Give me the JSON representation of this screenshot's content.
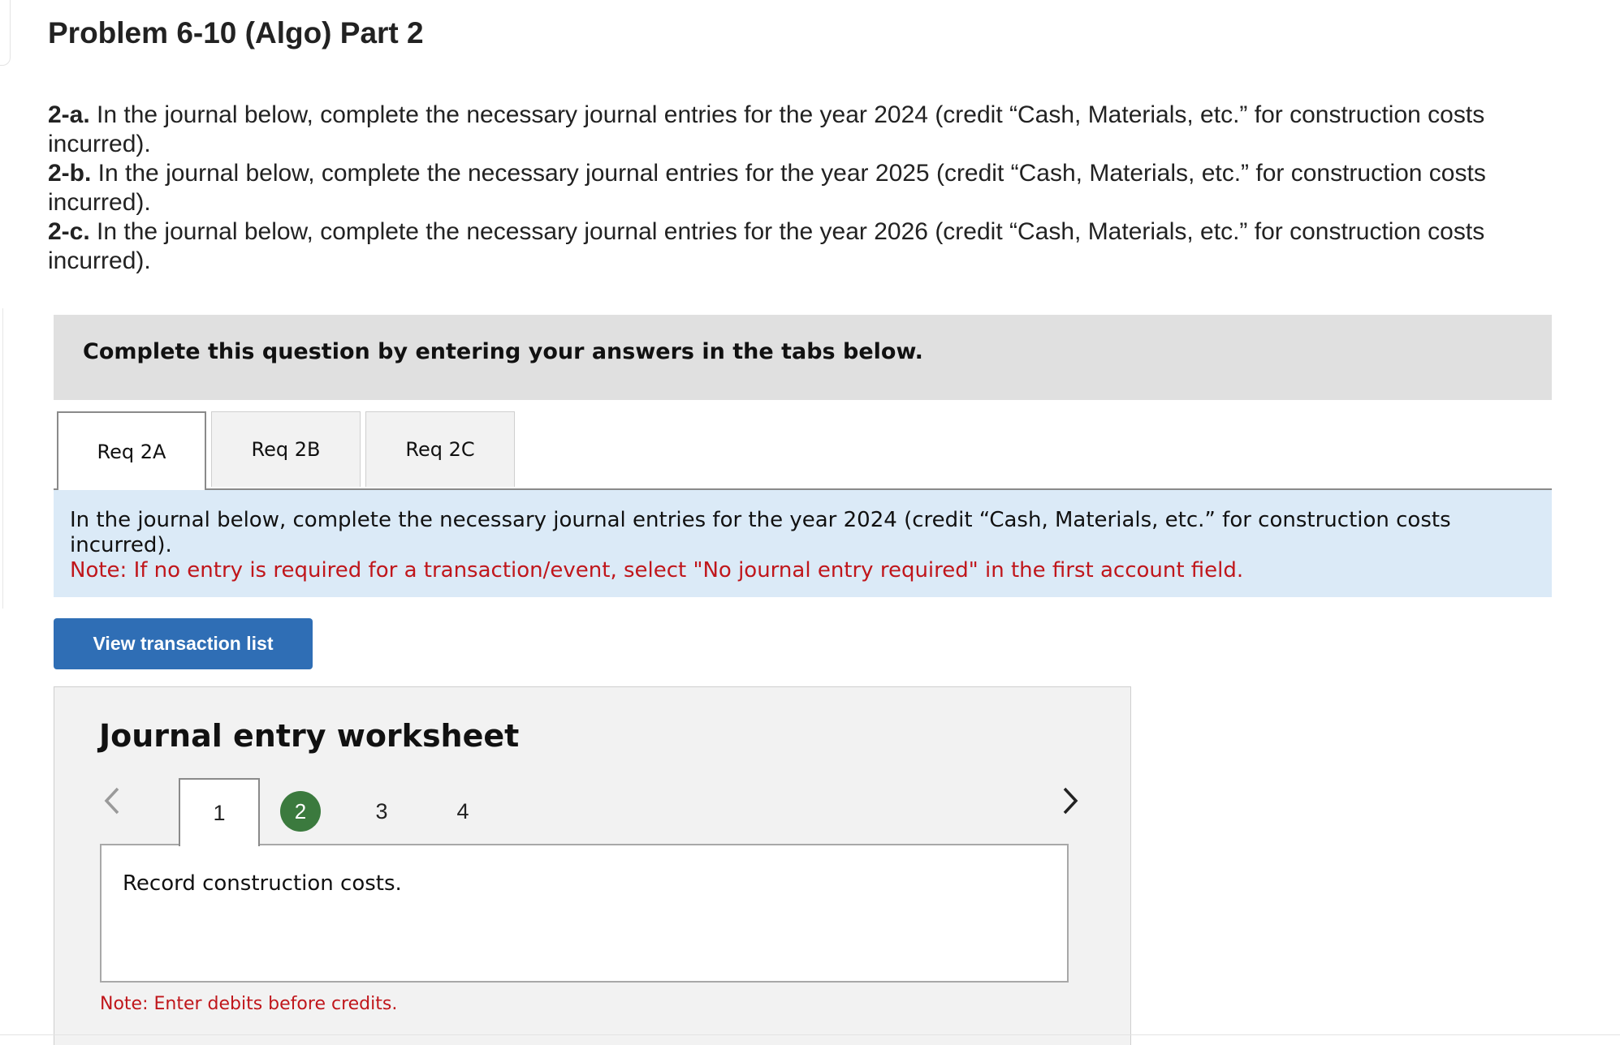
{
  "page": {
    "title": "Problem 6-10 (Algo) Part 2"
  },
  "instructions": [
    {
      "label": "2-a.",
      "text": " In the journal below, complete the necessary journal entries for the year 2024 (credit “Cash, Materials, etc.” for construction costs incurred)."
    },
    {
      "label": "2-b.",
      "text": " In the journal below, complete the necessary journal entries for the year 2025 (credit “Cash, Materials, etc.” for construction costs incurred)."
    },
    {
      "label": "2-c.",
      "text": " In the journal below, complete the necessary journal entries for the year 2026 (credit “Cash, Materials, etc.” for construction costs incurred)."
    }
  ],
  "banner": {
    "text": "Complete this question by entering your answers in the tabs below."
  },
  "tabs": [
    {
      "label": "Req 2A",
      "active": true
    },
    {
      "label": "Req 2B",
      "active": false
    },
    {
      "label": "Req 2C",
      "active": false
    }
  ],
  "info": {
    "text": "In the journal below, complete the necessary journal entries for the year 2024 (credit “Cash, Materials, etc.” for construction costs incurred).",
    "note": "Note: If no entry is required for a transaction/event, select \"No journal entry required\" in the first account field."
  },
  "buttons": {
    "view_transactions": "View transaction list"
  },
  "worksheet": {
    "title": "Journal entry worksheet",
    "prev_icon": "chevron-left-icon",
    "next_icon": "chevron-right-icon",
    "steps": [
      "1",
      "2",
      "3",
      "4"
    ],
    "current_step": "1",
    "completed_step": "2",
    "description": "Record construction costs.",
    "note": "Note: Enter debits before credits."
  },
  "colors": {
    "primary_button": "#2f6eb5",
    "info_background": "#dbeaf7",
    "note_red": "#c0161b",
    "step_complete_green": "#3b7a3e",
    "banner_gray": "#e0e0e0"
  }
}
